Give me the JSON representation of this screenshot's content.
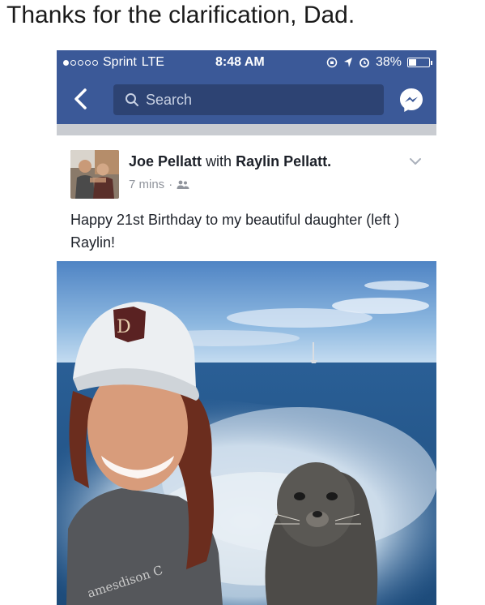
{
  "caption": "Thanks for the clarification, Dad.",
  "status_bar": {
    "carrier": "Sprint",
    "network": "LTE",
    "time": "8:48 AM",
    "battery": "38%",
    "battery_level": 0.38
  },
  "nav": {
    "search_placeholder": "Search"
  },
  "post": {
    "author": "Joe Pellatt",
    "with_text": "with",
    "tagged": "Raylin Pellatt.",
    "time": "7 mins",
    "separator": "·",
    "text": "Happy 21st Birthday to my beautiful daughter (left ) Raylin!"
  },
  "photo": {
    "shirt_text": "amesdison C"
  },
  "colors": {
    "facebook_blue": "#3b5998",
    "search_bg": "#2d4373",
    "feed_bg": "#e9ebee"
  }
}
